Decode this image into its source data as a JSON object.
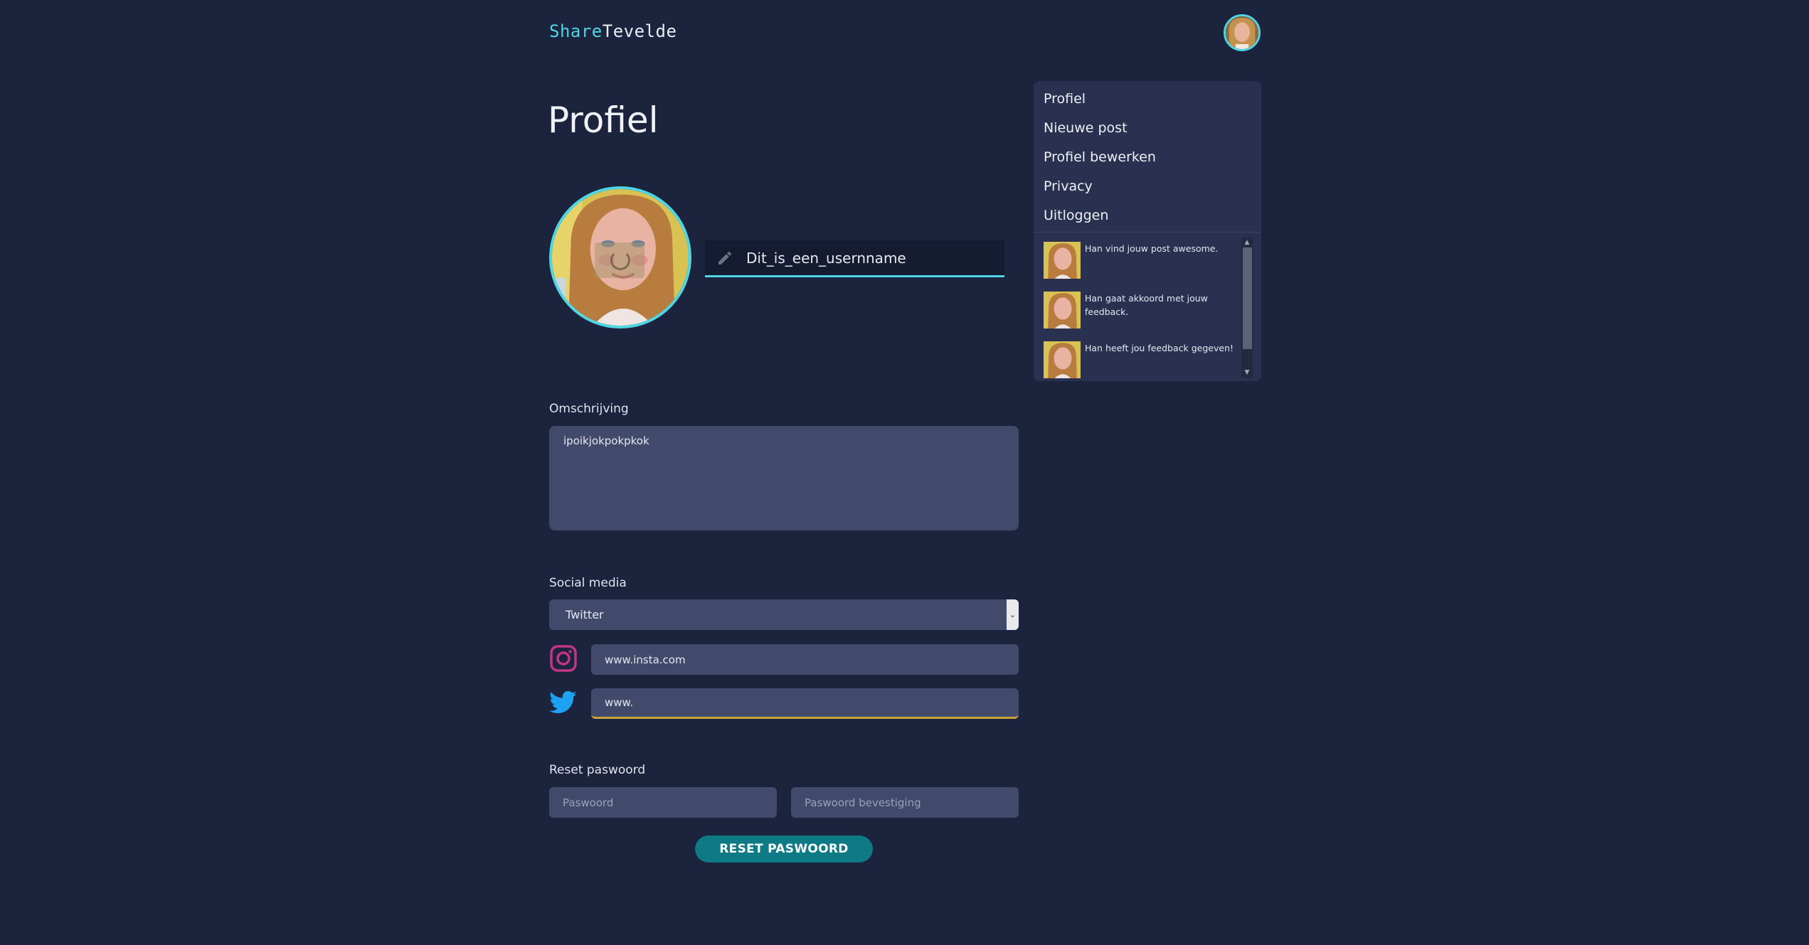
{
  "header": {
    "logo_part1": "Share",
    "logo_part2": "Tevelde",
    "avatar_icon": "user-avatar"
  },
  "page": {
    "title": "Profiel"
  },
  "profile": {
    "username": "Dit_is_een_usernname",
    "edit_icon": "pencil-icon"
  },
  "description": {
    "label": "Omschrijving",
    "value": "ipoikjokpokpkok"
  },
  "social": {
    "label": "Social media",
    "selected": "Twitter",
    "instagram_value": "www.insta.com",
    "twitter_value": "www.",
    "instagram_color": "#c13584",
    "twitter_color": "#1da1f2"
  },
  "password": {
    "label": "Reset paswoord",
    "password_placeholder": "Paswoord",
    "confirm_placeholder": "Paswoord bevestiging",
    "reset_button": "RESET PASWOORD"
  },
  "sidebar": {
    "menu": [
      {
        "label": "Profiel"
      },
      {
        "label": "Nieuwe post"
      },
      {
        "label": "Profiel bewerken"
      },
      {
        "label": "Privacy"
      },
      {
        "label": "Uitloggen"
      }
    ],
    "notifications": [
      {
        "text": "Han vind jouw post awesome."
      },
      {
        "text": "Han gaat akkoord met jouw feedback."
      },
      {
        "text": "Han heeft jou feedback gegeven!"
      }
    ]
  },
  "colors": {
    "background": "#1c233d",
    "accent": "#4fd6e4",
    "button": "#0d7a85",
    "input": "#424a6b"
  }
}
